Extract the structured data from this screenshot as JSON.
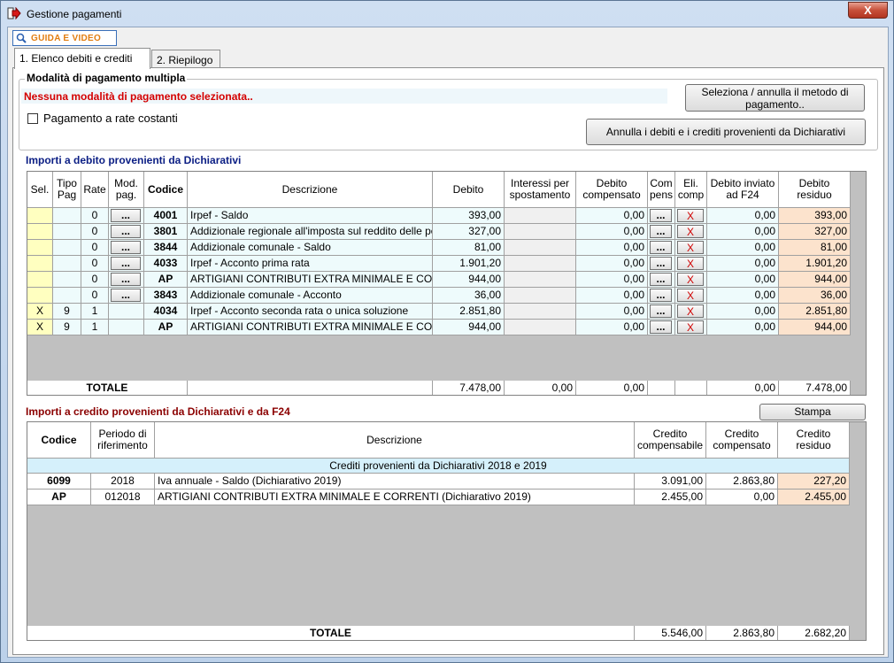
{
  "window": {
    "title": "Gestione pagamenti",
    "close_label": "X"
  },
  "guide_button": {
    "label": "GUIDA E VIDEO"
  },
  "tabs": [
    {
      "label": "1. Elenco debiti e crediti"
    },
    {
      "label": "2. Riepilogo"
    }
  ],
  "payment_group": {
    "title": "Modalità di pagamento multipla",
    "status": "Nessuna modalità di pagamento selezionata..",
    "checkbox_label": "Pagamento a rate costanti",
    "select_button": "Seleziona / annulla il metodo di pagamento..",
    "cancel_button": "Annulla i debiti e i crediti provenienti da Dichiarativi"
  },
  "debits": {
    "title": "Importi a debito provenienti da Dichiarativi",
    "columns": [
      "Sel.",
      "Tipo Pag",
      "Rate",
      "Mod. pag.",
      "Codice",
      "Descrizione",
      "Debito",
      "Interessi per spostamento",
      "Debito compensato",
      "Com pens",
      "Eli. comp",
      "Debito inviato ad F24",
      "Debito residuo"
    ],
    "rows": [
      {
        "sel": "",
        "tipo": "",
        "rate": "0",
        "mod": "...",
        "codice": "4001",
        "descrizione": "Irpef - Saldo",
        "debito": "393,00",
        "interessi": "",
        "compensato": "0,00",
        "compens": "...",
        "elim": "X",
        "inviato": "0,00",
        "residuo": "393,00"
      },
      {
        "sel": "",
        "tipo": "",
        "rate": "0",
        "mod": "...",
        "codice": "3801",
        "descrizione": "Addizionale regionale all'imposta sul reddito delle persone fisiche - Saldo",
        "debito": "327,00",
        "interessi": "",
        "compensato": "0,00",
        "compens": "...",
        "elim": "X",
        "inviato": "0,00",
        "residuo": "327,00"
      },
      {
        "sel": "",
        "tipo": "",
        "rate": "0",
        "mod": "...",
        "codice": "3844",
        "descrizione": "Addizionale comunale - Saldo",
        "debito": "81,00",
        "interessi": "",
        "compensato": "0,00",
        "compens": "...",
        "elim": "X",
        "inviato": "0,00",
        "residuo": "81,00"
      },
      {
        "sel": "",
        "tipo": "",
        "rate": "0",
        "mod": "...",
        "codice": "4033",
        "descrizione": "Irpef - Acconto prima rata",
        "debito": "1.901,20",
        "interessi": "",
        "compensato": "0,00",
        "compens": "...",
        "elim": "X",
        "inviato": "0,00",
        "residuo": "1.901,20"
      },
      {
        "sel": "",
        "tipo": "",
        "rate": "0",
        "mod": "...",
        "codice": "AP",
        "descrizione": "ARTIGIANI CONTRIBUTI EXTRA MINIMALE E CORRENTI",
        "debito": "944,00",
        "interessi": "",
        "compensato": "0,00",
        "compens": "...",
        "elim": "X",
        "inviato": "0,00",
        "residuo": "944,00"
      },
      {
        "sel": "",
        "tipo": "",
        "rate": "0",
        "mod": "...",
        "codice": "3843",
        "descrizione": "Addizionale comunale - Acconto",
        "debito": "36,00",
        "interessi": "",
        "compensato": "0,00",
        "compens": "...",
        "elim": "X",
        "inviato": "0,00",
        "residuo": "36,00"
      },
      {
        "sel": "X",
        "tipo": "9",
        "rate": "1",
        "mod": "",
        "codice": "4034",
        "descrizione": "Irpef - Acconto seconda rata o unica soluzione",
        "debito": "2.851,80",
        "interessi": "",
        "compensato": "0,00",
        "compens": "...",
        "elim": "X",
        "inviato": "0,00",
        "residuo": "2.851,80"
      },
      {
        "sel": "X",
        "tipo": "9",
        "rate": "1",
        "mod": "",
        "codice": "AP",
        "descrizione": "ARTIGIANI CONTRIBUTI EXTRA MINIMALE E CORRENTI",
        "debito": "944,00",
        "interessi": "",
        "compensato": "0,00",
        "compens": "...",
        "elim": "X",
        "inviato": "0,00",
        "residuo": "944,00"
      }
    ],
    "totals": {
      "label": "TOTALE",
      "debito": "7.478,00",
      "interessi": "0,00",
      "compensato": "0,00",
      "inviato": "0,00",
      "residuo": "7.478,00"
    }
  },
  "credits": {
    "title": "Importi a credito provenienti da Dichiarativi e da F24",
    "print_button": "Stampa",
    "columns": [
      "Codice",
      "Periodo di riferimento",
      "Descrizione",
      "Credito compensabile",
      "Credito compensato",
      "Credito residuo"
    ],
    "group_label": "Crediti provenienti da Dichiarativi 2018 e 2019",
    "rows": [
      {
        "codice": "6099",
        "periodo": "2018",
        "descrizione": "Iva annuale - Saldo (Dichiarativo 2019)",
        "compensabile": "3.091,00",
        "compensato": "2.863,80",
        "residuo": "227,20"
      },
      {
        "codice": "AP",
        "periodo": "012018",
        "descrizione": "ARTIGIANI CONTRIBUTI EXTRA MINIMALE E CORRENTI (Dichiarativo 2019)",
        "compensabile": "2.455,00",
        "compensato": "0,00",
        "residuo": "2.455,00"
      }
    ],
    "totals": {
      "label": "TOTALE",
      "compensabile": "5.546,00",
      "compensato": "2.863,80",
      "residuo": "2.682,20"
    }
  },
  "colors": {
    "accent_red": "#d40000",
    "debit_title": "#0b1e84",
    "credit_title": "#8b0000",
    "residuo_bg": "#fce3cd",
    "sel_bg": "#ffffc0"
  }
}
